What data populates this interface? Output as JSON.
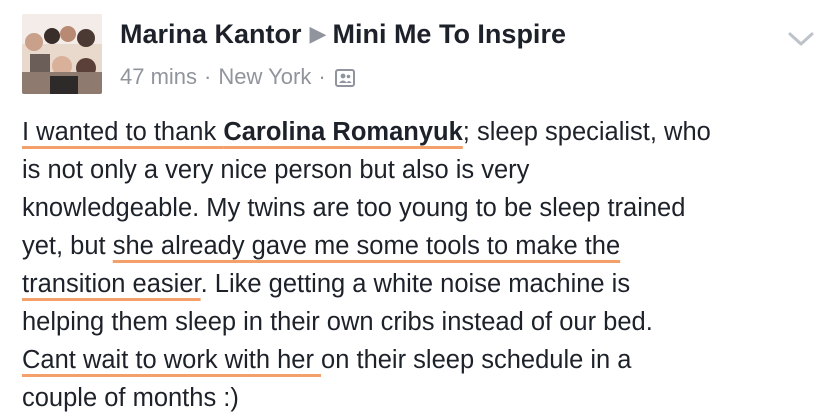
{
  "post": {
    "author": "Marina Kantor",
    "separator_icon": "right-triangle-icon",
    "group": "Mini Me To Inspire",
    "time": "47 mins",
    "location": "New York",
    "audience_icon": "friends-audience-icon",
    "menu_icon": "chevron-down-icon",
    "body": {
      "l1_a": "I wanted to thank ",
      "l1_b": "Carolina Romanyuk",
      "l1_c": "; sleep specialist, who",
      "l2": "is not only a very nice person but also is very",
      "l3": "knowledgeable. My twins are too young to be sleep trained",
      "l4_a": "yet, but ",
      "l4_b": "she already gave me some tools to make the",
      "l5_a": "transition easier",
      "l5_b": ". Like getting a white noise machine is",
      "l6": "helping them sleep in their own cribs instead of our bed.",
      "l7_a": "Cant wait to work with her ",
      "l7_b": "on their sleep schedule in a",
      "l8": "couple of months :)"
    },
    "underline_color": "#f4a06a"
  }
}
